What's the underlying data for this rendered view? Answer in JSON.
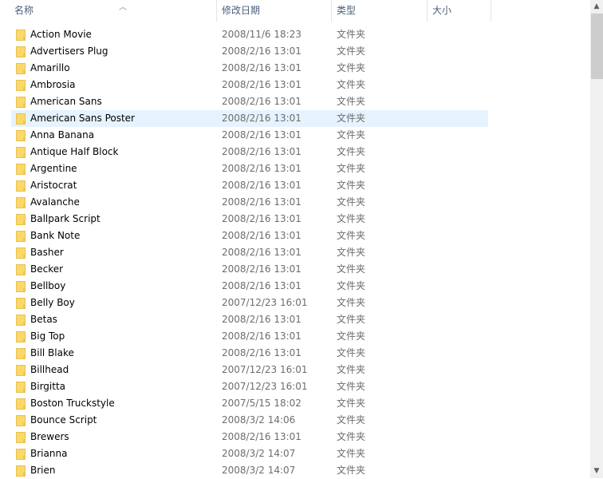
{
  "columns": {
    "name": "名称",
    "date": "修改日期",
    "type": "类型",
    "size": "大小"
  },
  "selected_index": 5,
  "rows": [
    {
      "name": "Action Movie",
      "date": "2008/11/6 18:23",
      "type": "文件夹"
    },
    {
      "name": "Advertisers Plug",
      "date": "2008/2/16 13:01",
      "type": "文件夹"
    },
    {
      "name": "Amarillo",
      "date": "2008/2/16 13:01",
      "type": "文件夹"
    },
    {
      "name": "Ambrosia",
      "date": "2008/2/16 13:01",
      "type": "文件夹"
    },
    {
      "name": "American Sans",
      "date": "2008/2/16 13:01",
      "type": "文件夹"
    },
    {
      "name": "American Sans Poster",
      "date": "2008/2/16 13:01",
      "type": "文件夹"
    },
    {
      "name": "Anna Banana",
      "date": "2008/2/16 13:01",
      "type": "文件夹"
    },
    {
      "name": "Antique Half Block",
      "date": "2008/2/16 13:01",
      "type": "文件夹"
    },
    {
      "name": "Argentine",
      "date": "2008/2/16 13:01",
      "type": "文件夹"
    },
    {
      "name": "Aristocrat",
      "date": "2008/2/16 13:01",
      "type": "文件夹"
    },
    {
      "name": "Avalanche",
      "date": "2008/2/16 13:01",
      "type": "文件夹"
    },
    {
      "name": "Ballpark Script",
      "date": "2008/2/16 13:01",
      "type": "文件夹"
    },
    {
      "name": "Bank Note",
      "date": "2008/2/16 13:01",
      "type": "文件夹"
    },
    {
      "name": "Basher",
      "date": "2008/2/16 13:01",
      "type": "文件夹"
    },
    {
      "name": "Becker",
      "date": "2008/2/16 13:01",
      "type": "文件夹"
    },
    {
      "name": "Bellboy",
      "date": "2008/2/16 13:01",
      "type": "文件夹"
    },
    {
      "name": "Belly Boy",
      "date": "2007/12/23 16:01",
      "type": "文件夹"
    },
    {
      "name": "Betas",
      "date": "2008/2/16 13:01",
      "type": "文件夹"
    },
    {
      "name": "Big Top",
      "date": "2008/2/16 13:01",
      "type": "文件夹"
    },
    {
      "name": "Bill Blake",
      "date": "2008/2/16 13:01",
      "type": "文件夹"
    },
    {
      "name": "Billhead",
      "date": "2007/12/23 16:01",
      "type": "文件夹"
    },
    {
      "name": "Birgitta",
      "date": "2007/12/23 16:01",
      "type": "文件夹"
    },
    {
      "name": "Boston Truckstyle",
      "date": "2007/5/15 18:02",
      "type": "文件夹"
    },
    {
      "name": "Bounce Script",
      "date": "2008/3/2 14:06",
      "type": "文件夹"
    },
    {
      "name": "Brewers",
      "date": "2008/2/16 13:01",
      "type": "文件夹"
    },
    {
      "name": "Brianna",
      "date": "2008/3/2 14:07",
      "type": "文件夹"
    },
    {
      "name": "Brien",
      "date": "2008/3/2 14:07",
      "type": "文件夹"
    }
  ]
}
